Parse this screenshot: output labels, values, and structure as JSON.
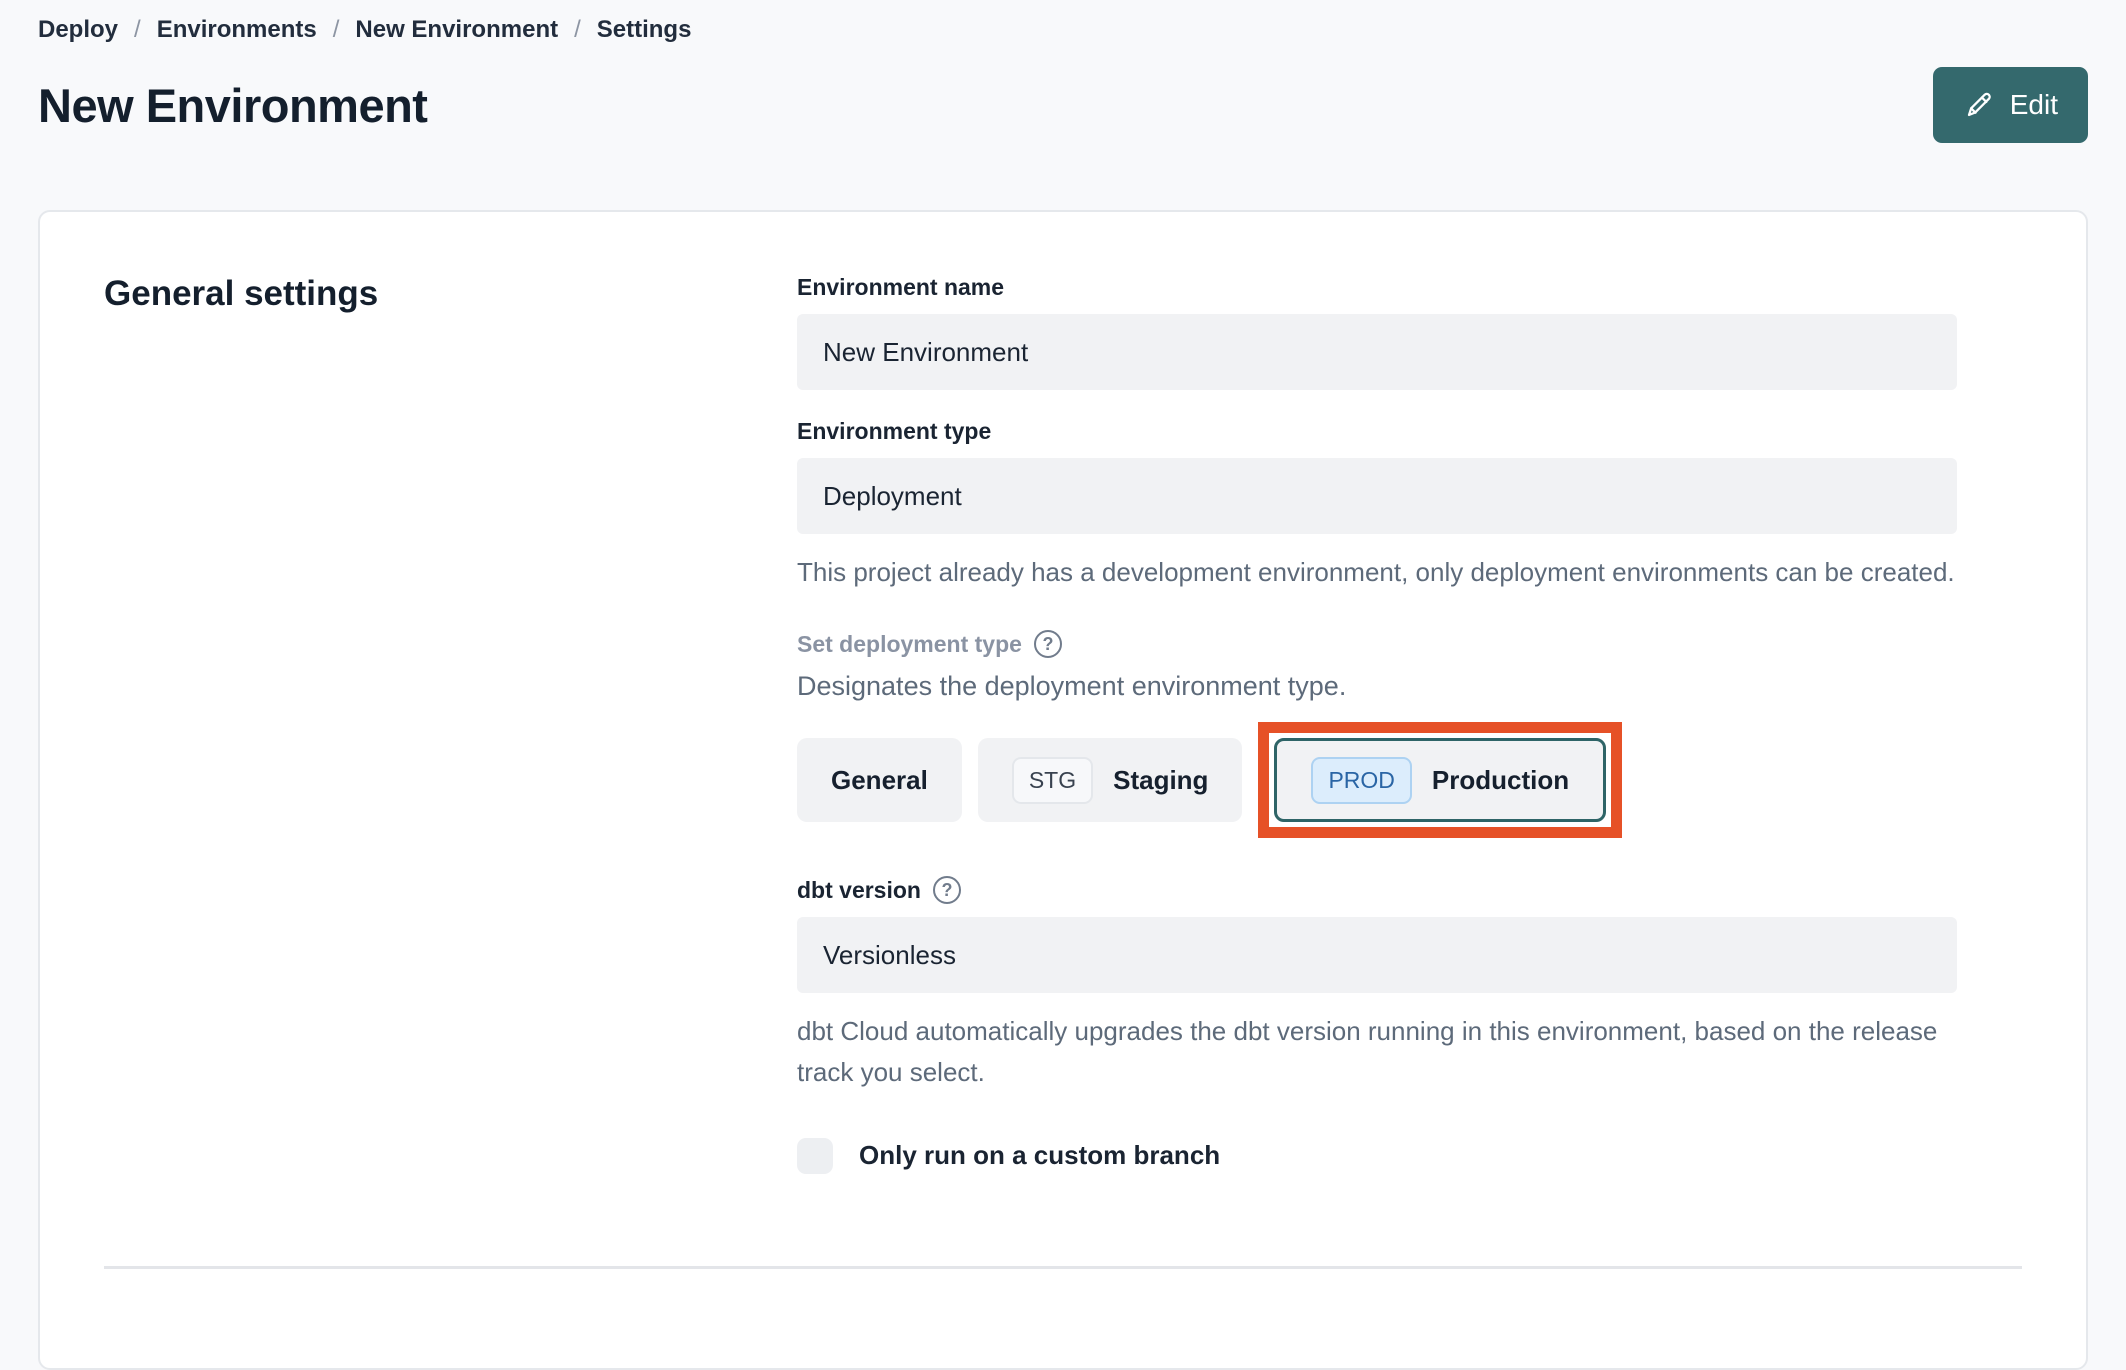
{
  "breadcrumb": {
    "separator": "/",
    "items": [
      "Deploy",
      "Environments",
      "New Environment",
      "Settings"
    ]
  },
  "header": {
    "title": "New Environment",
    "edit_button_label": "Edit"
  },
  "general_settings": {
    "heading": "General settings",
    "environment_name": {
      "label": "Environment name",
      "value": "New Environment"
    },
    "environment_type": {
      "label": "Environment type",
      "value": "Deployment",
      "helper": "This project already has a development environment, only deployment environments can be created."
    },
    "deployment_type": {
      "label": "Set deployment type",
      "help_icon": "?",
      "description": "Designates the deployment environment type.",
      "options": [
        {
          "label": "General",
          "badge": "",
          "selected": false
        },
        {
          "label": "Staging",
          "badge": "STG",
          "selected": false
        },
        {
          "label": "Production",
          "badge": "PROD",
          "selected": true,
          "annotated": true
        }
      ]
    },
    "dbt_version": {
      "label": "dbt version",
      "help_icon": "?",
      "value": "Versionless",
      "helper": "dbt Cloud automatically upgrades the dbt version running in this environment, based on the release track you select."
    },
    "custom_branch": {
      "label": "Only run on a custom branch",
      "checked": false
    }
  },
  "colors": {
    "accent_teal": "#34696d",
    "selected_border_teal": "#2e6467",
    "annotation_orange": "#e65127",
    "prod_badge_bg": "#dcedfc",
    "prod_badge_border": "#add2f2",
    "prod_badge_text": "#2a65a5",
    "field_bg": "#f1f2f4",
    "page_bg": "#f8f9fb"
  }
}
